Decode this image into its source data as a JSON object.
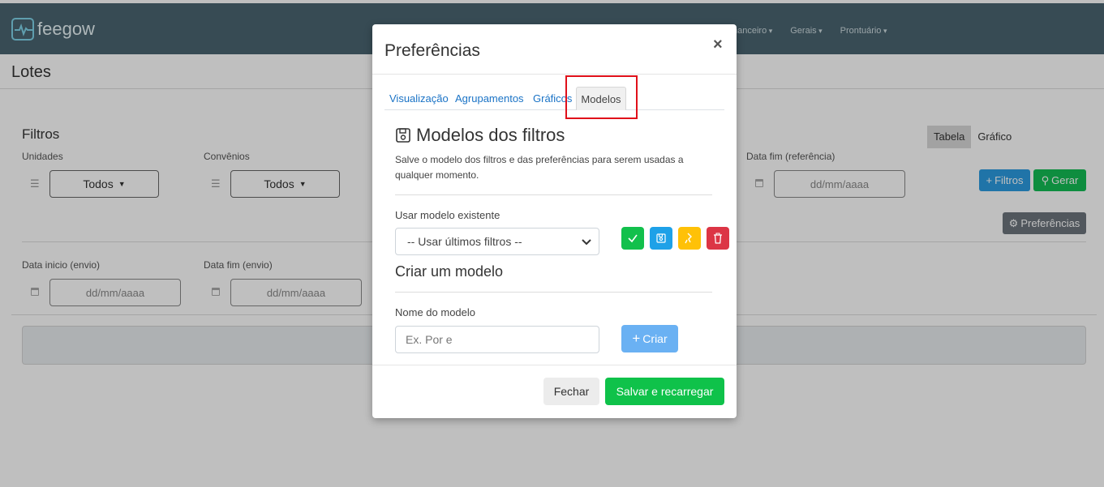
{
  "app": {
    "logo_text": "feegow"
  },
  "topnav": {
    "items": [
      "nanceiro",
      "Gerais",
      "Prontuário"
    ]
  },
  "page": {
    "title": "Lotes"
  },
  "filters": {
    "heading": "Filtros",
    "unidades_label": "Unidades",
    "unidades_value": "Todos",
    "convenios_label": "Convênios",
    "convenios_value": "Todos",
    "data_fim_ref_label": "Data fim (referência)",
    "data_fim_ref_placeholder": "dd/mm/aaaa",
    "data_inicio_envio_label": "Data inicio (envio)",
    "data_inicio_envio_placeholder": "dd/mm/aaaa",
    "data_fim_envio_label": "Data fim (envio)",
    "data_fim_envio_placeholder": "dd/mm/aaaa"
  },
  "view_toggle": {
    "tabela": "Tabela",
    "grafico": "Gráfico"
  },
  "actions": {
    "filtros": "Filtros",
    "gerar": "Gerar",
    "preferencias": "Preferências"
  },
  "modal": {
    "title": "Preferências",
    "close": "×",
    "tabs": [
      "Visualização",
      "Agrupamentos",
      "Gráficos",
      "Modelos"
    ],
    "section_title": "Modelos dos filtros",
    "description": "Salve o modelo dos filtros e das preferências para serem usadas a qualquer momento.",
    "existing_label": "Usar modelo existente",
    "existing_selected": "-- Usar últimos filtros --",
    "create_title": "Criar um modelo",
    "name_label": "Nome do modelo",
    "name_placeholder": "Ex. Por  e",
    "create_button": "Criar",
    "close_button": "Fechar",
    "save_button": "Salvar e recarregar"
  },
  "colors": {
    "topbar": "#4a6470",
    "primary": "#1a73c6",
    "success": "#0fc24a",
    "info": "#1ea1e8",
    "warning": "#ffc107",
    "danger": "#dc3545",
    "highlight": "#e0101a"
  }
}
